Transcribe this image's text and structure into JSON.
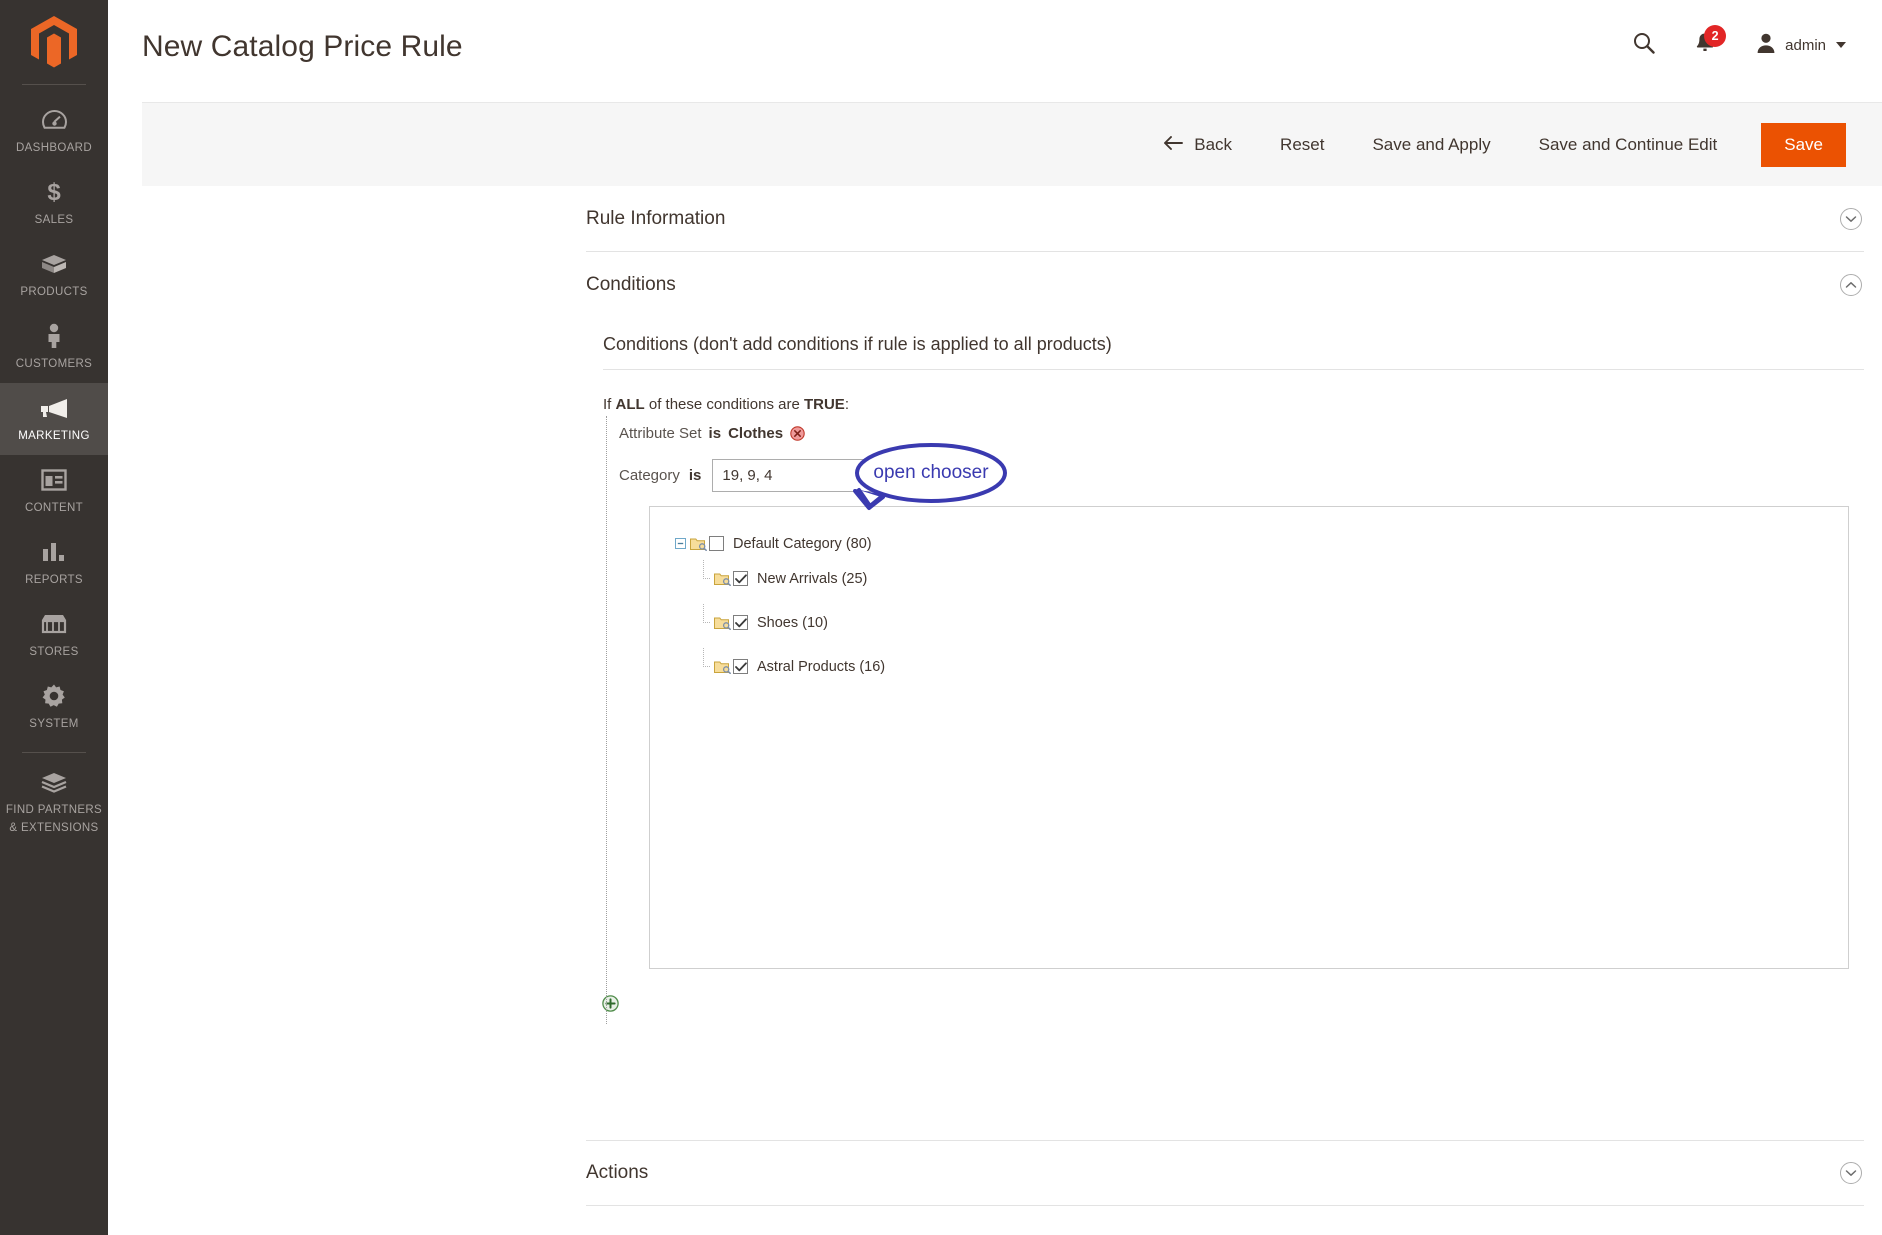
{
  "app": {
    "logo_name": "magento-logo-icon"
  },
  "sidebar": {
    "items": [
      {
        "label": "DASHBOARD",
        "icon": "dashboard-icon",
        "active": false
      },
      {
        "label": "SALES",
        "icon": "dollar-icon",
        "active": false
      },
      {
        "label": "PRODUCTS",
        "icon": "box-icon",
        "active": false
      },
      {
        "label": "CUSTOMERS",
        "icon": "person-icon",
        "active": false
      },
      {
        "label": "MARKETING",
        "icon": "megaphone-icon",
        "active": true
      },
      {
        "label": "CONTENT",
        "icon": "layout-icon",
        "active": false
      },
      {
        "label": "REPORTS",
        "icon": "bar-chart-icon",
        "active": false
      },
      {
        "label": "STORES",
        "icon": "storefront-icon",
        "active": false
      },
      {
        "label": "SYSTEM",
        "icon": "gear-icon",
        "active": false
      },
      {
        "label": "FIND PARTNERS\n& EXTENSIONS",
        "label_line1": "FIND PARTNERS",
        "label_line2": "& EXTENSIONS",
        "icon": "partners-icon",
        "active": false
      }
    ]
  },
  "header": {
    "title": "New Catalog Price Rule",
    "search_icon": "search-icon",
    "notifications": {
      "icon": "bell-icon",
      "count": "2",
      "badge_color": "#e22626"
    },
    "user": {
      "avatar_icon": "user-avatar-icon",
      "name": "admin",
      "caret": "chevron-down-icon"
    }
  },
  "toolbar": {
    "back_label": "Back",
    "back_icon": "arrow-left-icon",
    "reset_label": "Reset",
    "save_and_apply_label": "Save and Apply",
    "save_and_continue_label": "Save and Continue Edit",
    "save_label": "Save",
    "save_color": "#eb5202"
  },
  "sections": [
    {
      "title": "Rule Information",
      "state": "collapsed",
      "chevron": "chevron-down-icon"
    },
    {
      "title": "Conditions",
      "state": "expanded",
      "chevron": "chevron-up-icon"
    },
    {
      "title": "Actions",
      "state": "collapsed",
      "chevron": "chevron-down-icon"
    }
  ],
  "conditions": {
    "legend": "Conditions (don't add conditions if rule is applied to all products)",
    "if_prefix": "If",
    "aggregator": "ALL",
    "if_middle": "of these conditions are",
    "truth_value": "TRUE",
    "if_suffix": ":",
    "rules": [
      {
        "attribute_label": "Attribute Set",
        "operator": "is",
        "value": "Clothes",
        "delete_icon": "delete-circle-icon"
      },
      {
        "attribute_label": "Category",
        "operator": "is",
        "value": "19, 9, 4",
        "chooser_icon": "chooser-list-icon",
        "apply_icon": "apply-check-icon",
        "delete_icon": "delete-circle-icon"
      }
    ],
    "add_icon": "add-circle-icon",
    "tree": [
      {
        "label": "Default Category (80)",
        "level": 0,
        "checked": false,
        "expanded": true,
        "folder_icon": "folder-icon"
      },
      {
        "label": "New Arrivals (25)",
        "level": 1,
        "checked": true,
        "folder_icon": "folder-icon"
      },
      {
        "label": "Shoes (10)",
        "level": 1,
        "checked": true,
        "folder_icon": "folder-icon"
      },
      {
        "label": "Astral Products (16)",
        "level": 1,
        "checked": true,
        "folder_icon": "folder-icon"
      }
    ]
  },
  "annotation": {
    "text": "open chooser",
    "color": "#3a3ab0",
    "shape": "speech-bubble"
  }
}
